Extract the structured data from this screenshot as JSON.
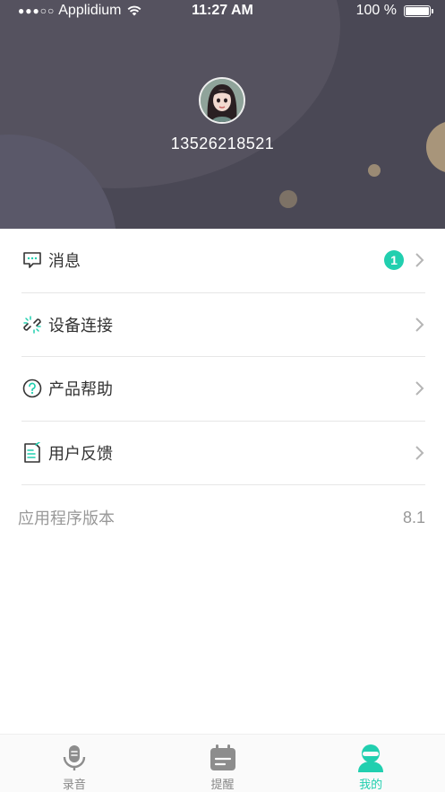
{
  "status_bar": {
    "signal": "●●●○○",
    "carrier": "Applidium",
    "time": "11:27 AM",
    "battery": "100 %"
  },
  "profile": {
    "phone": "13526218521"
  },
  "menu": {
    "items": [
      {
        "label": "消息",
        "icon": "message-icon",
        "badge": "1"
      },
      {
        "label": "设备连接",
        "icon": "link-icon"
      },
      {
        "label": "产品帮助",
        "icon": "help-icon"
      },
      {
        "label": "用户反馈",
        "icon": "feedback-icon"
      }
    ]
  },
  "version": {
    "label": "应用程序版本",
    "value": "8.1"
  },
  "tabs": [
    {
      "label": "录音",
      "icon": "microphone-icon",
      "active": false
    },
    {
      "label": "提醒",
      "icon": "calendar-icon",
      "active": false
    },
    {
      "label": "我的",
      "icon": "user-icon",
      "active": true
    }
  ],
  "colors": {
    "accent": "#21cfaf",
    "header": "#4a4855"
  }
}
